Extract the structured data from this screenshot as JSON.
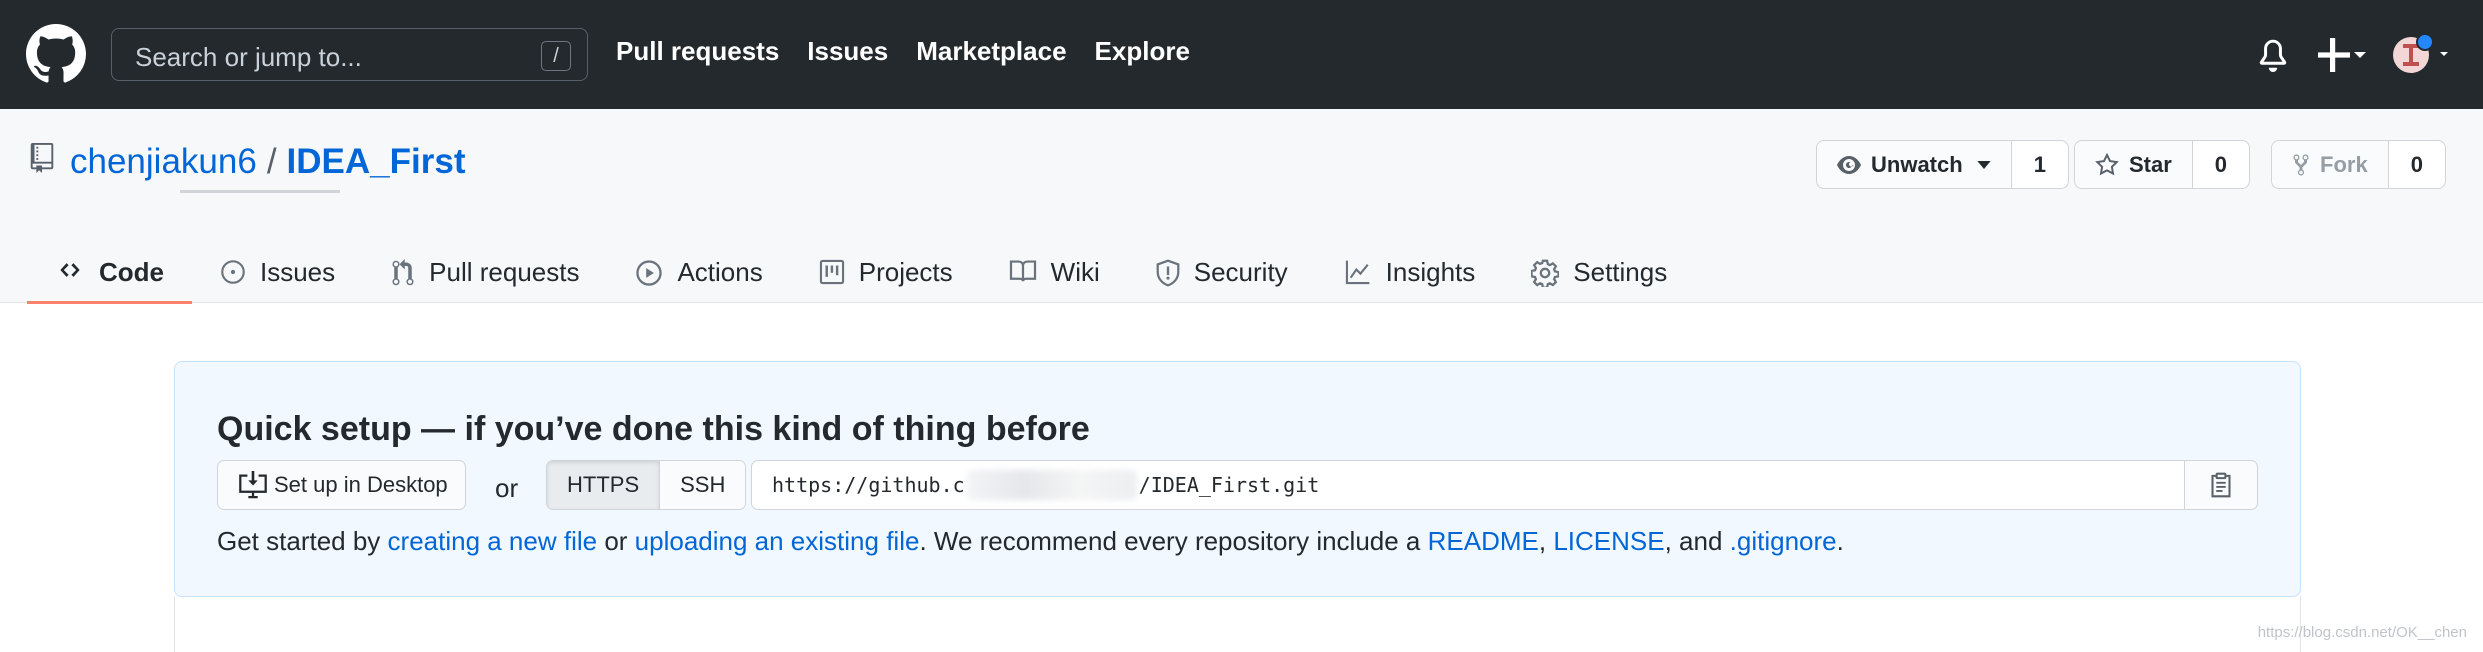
{
  "header": {
    "search_placeholder": "Search or jump to...",
    "search_shortcut": "/",
    "nav": [
      "Pull requests",
      "Issues",
      "Marketplace",
      "Explore"
    ]
  },
  "repo": {
    "owner": "chenjiakun6",
    "separator": "/",
    "name": "IDEA_First",
    "watch_label": "Unwatch",
    "watch_count": "1",
    "star_label": "Star",
    "star_count": "0",
    "fork_label": "Fork",
    "fork_count": "0"
  },
  "tabs": [
    {
      "label": "Code",
      "icon": "code-icon",
      "active": true
    },
    {
      "label": "Issues",
      "icon": "issue-opened-icon"
    },
    {
      "label": "Pull requests",
      "icon": "git-pull-request-icon"
    },
    {
      "label": "Actions",
      "icon": "play-icon"
    },
    {
      "label": "Projects",
      "icon": "project-icon"
    },
    {
      "label": "Wiki",
      "icon": "book-icon"
    },
    {
      "label": "Security",
      "icon": "shield-icon"
    },
    {
      "label": "Insights",
      "icon": "graph-icon"
    },
    {
      "label": "Settings",
      "icon": "gear-icon"
    }
  ],
  "quick_setup": {
    "title": "Quick setup — if you’ve done this kind of thing before",
    "desktop_button": "Set up in Desktop",
    "or": "or",
    "protocols": [
      "HTTPS",
      "SSH"
    ],
    "selected_protocol": "HTTPS",
    "url_prefix": "https://github.c",
    "url_suffix": "/IDEA_First.git",
    "getting_started": {
      "t1": "Get started by ",
      "link1": "creating a new file",
      "t2": " or ",
      "link2": "uploading an existing file",
      "t3": ". We recommend every repository include a ",
      "link3": "README",
      "t4": ", ",
      "link4": "LICENSE",
      "t5": ", and ",
      "link5": ".gitignore",
      "t6": "."
    }
  },
  "watermark": "https://blog.csdn.net/OK__chen",
  "colors": {
    "header_bg": "#24292e",
    "link": "#0366d6",
    "active_tab_underline": "#f9826c",
    "quick_setup_bg": "#f1f8ff"
  }
}
